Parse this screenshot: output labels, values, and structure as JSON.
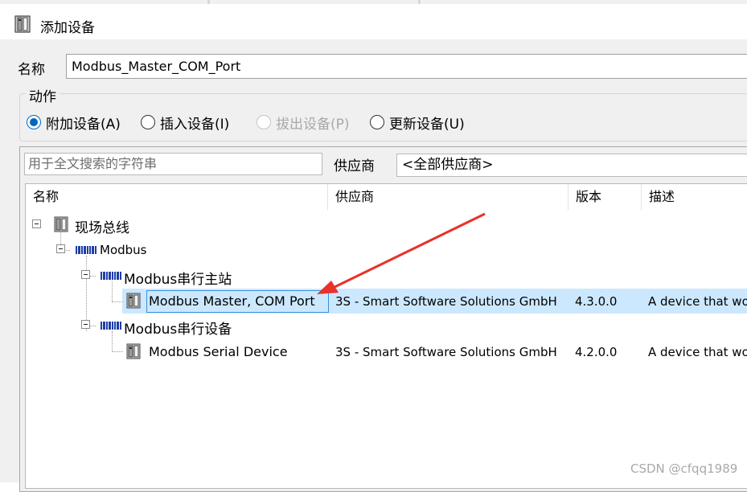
{
  "dialog": {
    "title": "添加设备",
    "icon": "device-chassis-icon"
  },
  "name_field": {
    "label": "名称",
    "value": "Modbus_Master_COM_Port"
  },
  "action_group": {
    "legend": "动作",
    "options": [
      {
        "label": "附加设备(A)",
        "selected": true,
        "enabled": true
      },
      {
        "label": "插入设备(I)",
        "selected": false,
        "enabled": true
      },
      {
        "label": "拔出设备(P)",
        "selected": false,
        "enabled": false
      },
      {
        "label": "更新设备(U)",
        "selected": false,
        "enabled": true
      }
    ]
  },
  "search": {
    "placeholder": "用于全文搜索的字符串"
  },
  "vendor_filter": {
    "label": "供应商",
    "selected": "<全部供应商>"
  },
  "table": {
    "columns": [
      "名称",
      "供应商",
      "版本",
      "描述"
    ],
    "tree": [
      {
        "name": "现场总线",
        "icon": "fieldbus-icon",
        "expanded": true
      },
      {
        "name": "Modbus",
        "icon": "modbus-icon",
        "expanded": true
      },
      {
        "name": "Modbus串行主站",
        "icon": "modbus-icon",
        "expanded": true
      },
      {
        "name": "Modbus Master, COM Port",
        "icon": "device-icon",
        "vendor": "3S - Smart Software Solutions GmbH",
        "version": "4.3.0.0",
        "description": "A device that wor",
        "selected": true
      },
      {
        "name": "Modbus串行设备",
        "icon": "modbus-icon",
        "expanded": true
      },
      {
        "name": "Modbus Serial Device",
        "icon": "device-icon",
        "vendor": "3S - Smart Software Solutions GmbH",
        "version": "4.2.0.0",
        "description": "A device that wor"
      }
    ]
  },
  "annotation": {
    "color": "#e8322a"
  },
  "watermark": "CSDN @cfqq1989",
  "colors": {
    "selection": "#cce8ff",
    "accent": "#0067c0",
    "arrow": "#e8322a"
  }
}
